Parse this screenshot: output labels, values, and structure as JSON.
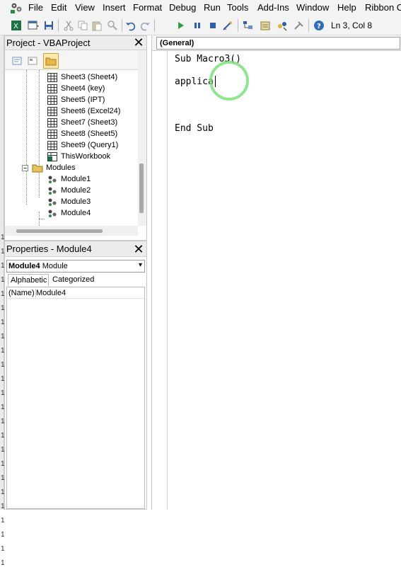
{
  "menu": {
    "items": [
      "File",
      "Edit",
      "View",
      "Insert",
      "Format",
      "Debug",
      "Run",
      "Tools",
      "Add-Ins",
      "Window",
      "Help",
      "Ribbon C"
    ]
  },
  "toolbar": {
    "status_position": "Ln 3, Col 8"
  },
  "left_strip_marks": [
    "1",
    "1",
    "1",
    "1",
    "1",
    "1",
    "1",
    "1",
    "1",
    "1",
    "1",
    "1",
    "1",
    "1",
    "1",
    "1",
    "1",
    "1",
    "1",
    "1",
    "1",
    "1",
    "1",
    "1"
  ],
  "project_panel": {
    "title": "Project - VBAProject",
    "close_glyph": "✕",
    "tree": [
      {
        "label": "Sheet3 (Sheet4)",
        "kind": "sheet"
      },
      {
        "label": "Sheet4 (key)",
        "kind": "sheet"
      },
      {
        "label": "Sheet5 (IPT)",
        "kind": "sheet"
      },
      {
        "label": "Sheet6 (Excel24)",
        "kind": "sheet"
      },
      {
        "label": "Sheet7 (Sheet3)",
        "kind": "sheet"
      },
      {
        "label": "Sheet8 (Sheet5)",
        "kind": "sheet"
      },
      {
        "label": "Sheet9 (Query1)",
        "kind": "sheet"
      },
      {
        "label": "ThisWorkbook",
        "kind": "workbook"
      },
      {
        "label": "Modules",
        "kind": "folder"
      },
      {
        "label": "Module1",
        "kind": "module"
      },
      {
        "label": "Module2",
        "kind": "module"
      },
      {
        "label": "Module3",
        "kind": "module"
      },
      {
        "label": "Module4",
        "kind": "module"
      }
    ]
  },
  "properties_panel": {
    "title": "Properties - Module4",
    "close_glyph": "✕",
    "selected_object_name": "Module4",
    "selected_object_type": "Module",
    "tabs": [
      "Alphabetic",
      "Categorized"
    ],
    "rows": [
      {
        "key": "(Name)",
        "value": "Module4"
      }
    ]
  },
  "code_window": {
    "object_combo": "(General)",
    "lines": [
      "Sub Macro3()",
      "",
      "applica",
      "",
      "",
      "End Sub"
    ]
  },
  "colors": {
    "cursor_ring": "#7de27d",
    "active_tool": "#fde9a9"
  }
}
